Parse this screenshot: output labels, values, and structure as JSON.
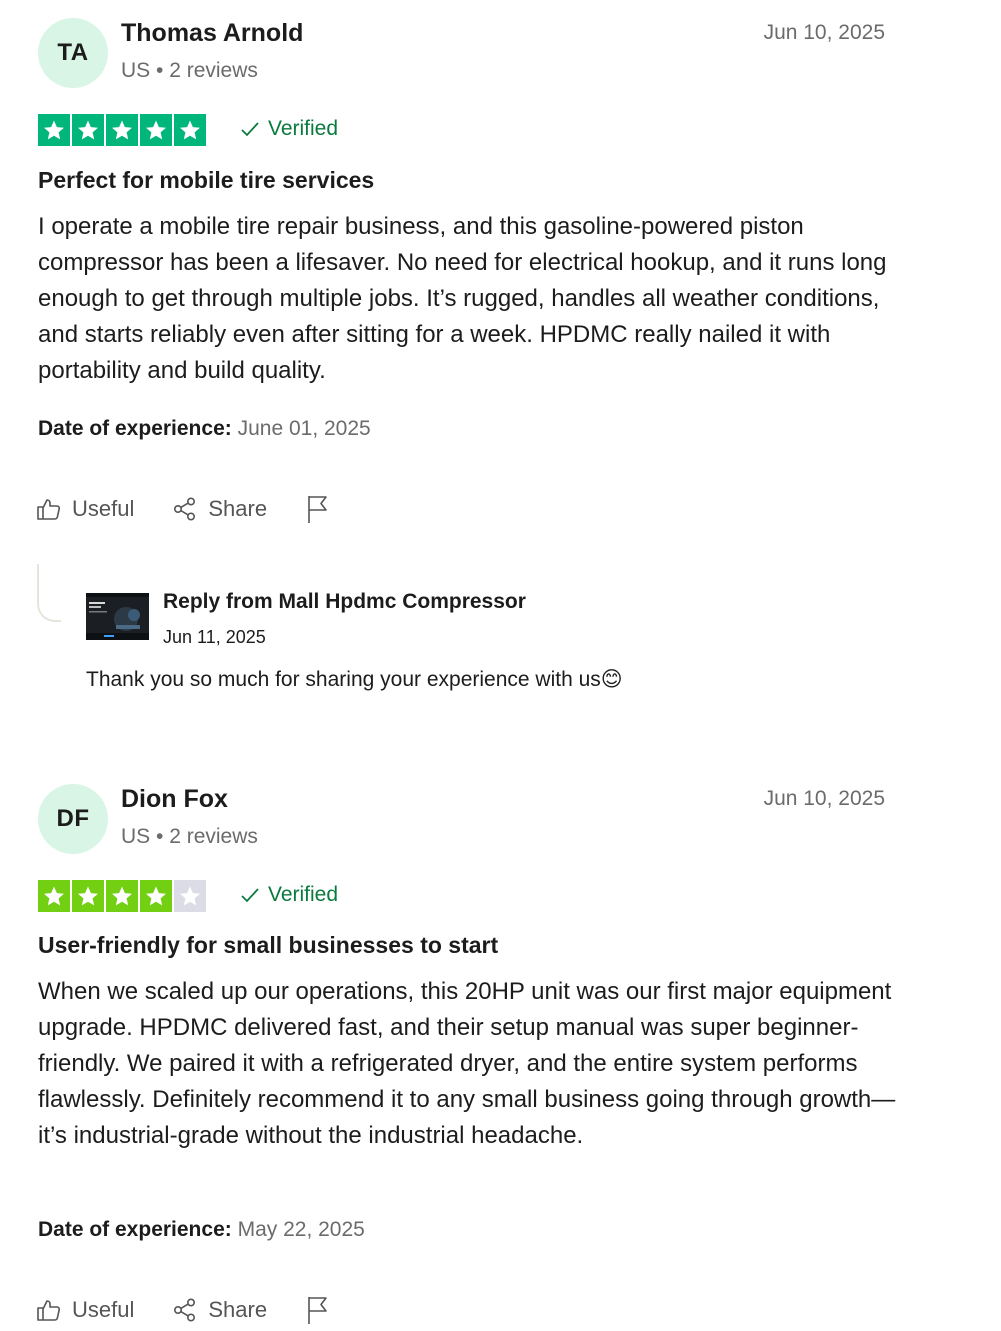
{
  "reviews": [
    {
      "initials": "TA",
      "name": "Thomas Arnold",
      "meta": "US • 2 reviews",
      "date": "Jun 10, 2025",
      "rating": 5,
      "verified_label": "Verified",
      "title": "Perfect for mobile tire services",
      "body": "I operate a mobile tire repair business, and this gasoline-powered piston compressor has been a lifesaver. No need for electrical hookup, and it runs long enough to get through multiple jobs. It’s rugged, handles all weather conditions, and starts reliably even after sitting for a week. HPDMC really nailed it with portability and build quality.",
      "experience_label": "Date of experience:",
      "experience_date": "June 01, 2025",
      "useful_label": "Useful",
      "share_label": "Share",
      "reply": {
        "title": "Reply from Mall Hpdmc Compressor",
        "date": "Jun 11, 2025",
        "text": "Thank you so much for sharing your experience with us😊"
      }
    },
    {
      "initials": "DF",
      "name": "Dion Fox",
      "meta": "US • 2 reviews",
      "date": "Jun 10, 2025",
      "rating": 4,
      "verified_label": "Verified",
      "title": "User-friendly for small businesses to start",
      "body": "When we scaled up our operations, this 20HP unit was our first major equipment upgrade. HPDMC delivered fast, and their setup manual was super beginner-friendly. We paired it with a refrigerated dryer, and the entire system performs flawlessly. Definitely recommend it to any small business going through growth—it’s industrial-grade without the industrial headache.",
      "experience_label": "Date of experience:",
      "experience_date": "May 22, 2025",
      "useful_label": "Useful",
      "share_label": "Share"
    }
  ],
  "colors": {
    "star_five": "#00b67a",
    "star_four": "#73cf11",
    "star_empty": "#dcdce6",
    "verified": "#0b7a3e",
    "avatar_bg": "#d8f5e6"
  },
  "icons": [
    "check-icon",
    "thumbs-up-icon",
    "share-icon",
    "flag-icon",
    "star-icon"
  ]
}
